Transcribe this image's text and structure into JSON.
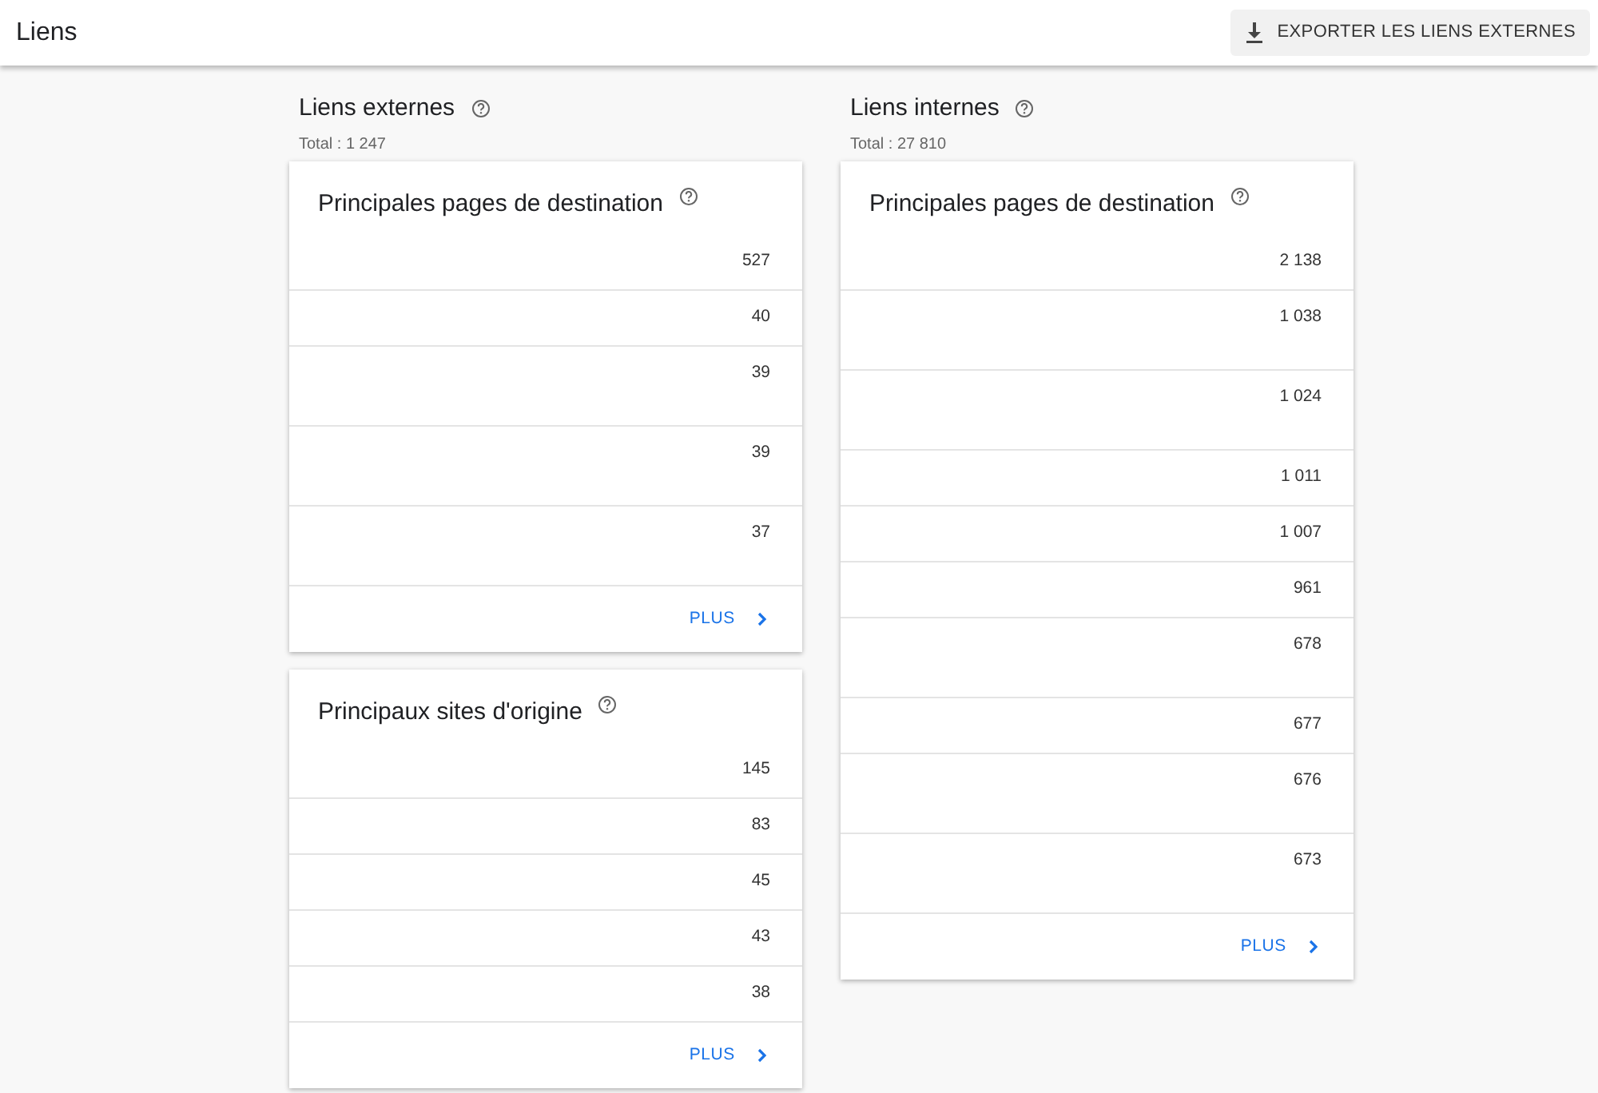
{
  "header": {
    "title": "Liens",
    "export_button": "EXPORTER LES LIENS EXTERNES"
  },
  "sections": [
    {
      "title": "Liens externes",
      "total": "Total : 1 247",
      "cards": [
        {
          "title": "Principales pages de destination",
          "more": "PLUS",
          "rows": [
            {
              "value": "527",
              "tall": false
            },
            {
              "value": "40",
              "tall": false
            },
            {
              "value": "39",
              "tall": true
            },
            {
              "value": "39",
              "tall": true
            },
            {
              "value": "37",
              "tall": true
            }
          ]
        },
        {
          "title": "Principaux sites d'origine",
          "more": "PLUS",
          "rows": [
            {
              "value": "145",
              "tall": false
            },
            {
              "value": "83",
              "tall": false
            },
            {
              "value": "45",
              "tall": false
            },
            {
              "value": "43",
              "tall": false
            },
            {
              "value": "38",
              "tall": false
            }
          ]
        }
      ]
    },
    {
      "title": "Liens internes",
      "total": "Total : 27 810",
      "cards": [
        {
          "title": "Principales pages de destination",
          "more": "PLUS",
          "rows": [
            {
              "value": "2 138",
              "tall": false
            },
            {
              "value": "1 038",
              "tall": true
            },
            {
              "value": "1 024",
              "tall": true
            },
            {
              "value": "1 011",
              "tall": false
            },
            {
              "value": "1 007",
              "tall": false
            },
            {
              "value": "961",
              "tall": false
            },
            {
              "value": "678",
              "tall": true
            },
            {
              "value": "677",
              "tall": false
            },
            {
              "value": "676",
              "tall": true
            },
            {
              "value": "673",
              "tall": true
            }
          ]
        }
      ]
    }
  ]
}
